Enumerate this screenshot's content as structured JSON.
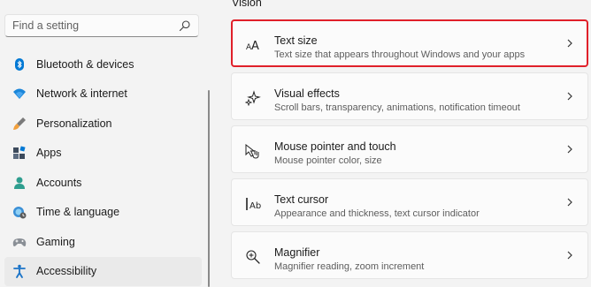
{
  "search": {
    "placeholder": "Find a setting"
  },
  "sidebar": {
    "items": [
      {
        "label": "Bluetooth & devices",
        "icon": "bluetooth-icon"
      },
      {
        "label": "Network & internet",
        "icon": "wifi-icon"
      },
      {
        "label": "Personalization",
        "icon": "brush-icon"
      },
      {
        "label": "Apps",
        "icon": "apps-icon"
      },
      {
        "label": "Accounts",
        "icon": "person-icon"
      },
      {
        "label": "Time & language",
        "icon": "globe-clock-icon"
      },
      {
        "label": "Gaming",
        "icon": "gamepad-icon"
      },
      {
        "label": "Accessibility",
        "icon": "accessibility-icon",
        "active": true
      }
    ]
  },
  "main": {
    "section_title": "Vision",
    "cards": [
      {
        "title": "Text size",
        "desc": "Text size that appears throughout Windows and your apps",
        "icon": "text-size-icon"
      },
      {
        "title": "Visual effects",
        "desc": "Scroll bars, transparency, animations, notification timeout",
        "icon": "sparkle-icon"
      },
      {
        "title": "Mouse pointer and touch",
        "desc": "Mouse pointer color, size",
        "icon": "pointer-touch-icon"
      },
      {
        "title": "Text cursor",
        "desc": "Appearance and thickness, text cursor indicator",
        "icon": "text-cursor-icon"
      },
      {
        "title": "Magnifier",
        "desc": "Magnifier reading, zoom increment",
        "icon": "magnifier-icon"
      }
    ]
  },
  "colors": {
    "accent": "#0067c0",
    "highlight_border": "#e0202a"
  }
}
